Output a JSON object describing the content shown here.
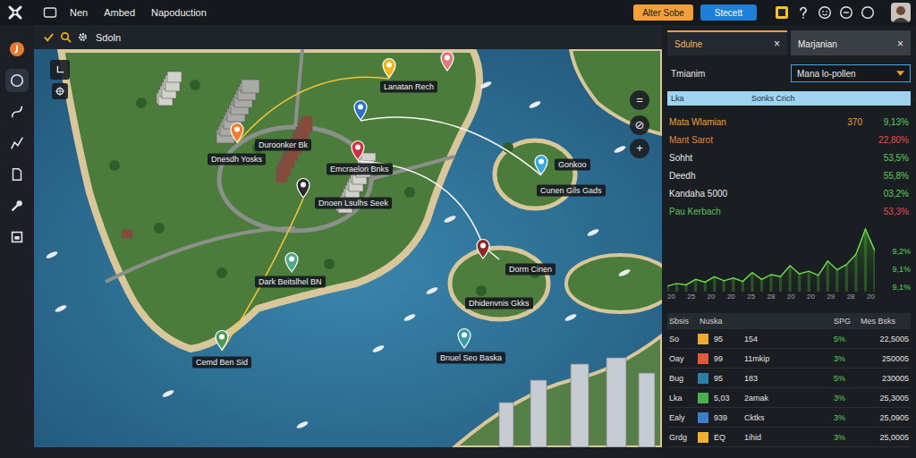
{
  "topbar": {
    "nav": [
      {
        "label": "Nen",
        "selected": false
      },
      {
        "label": "Ambed",
        "selected": false
      },
      {
        "label": "Napoduction",
        "selected": false
      }
    ],
    "buttons": [
      {
        "label": "Alter Sobe",
        "kind": "warning"
      },
      {
        "label": "Stecett",
        "kind": "primary"
      }
    ]
  },
  "sidebar": {
    "items": [
      {
        "selected": false
      },
      {
        "selected": true
      },
      {
        "selected": false
      },
      {
        "selected": false
      },
      {
        "selected": false
      },
      {
        "selected": false
      },
      {
        "selected": false
      }
    ]
  },
  "toolbar": {
    "title": "Sdoln"
  },
  "map": {
    "controls": [
      "=",
      "⊘",
      "+"
    ],
    "pins": [
      {
        "color": "#e07a7a"
      },
      {
        "color": "#f2b51c"
      },
      {
        "color": "#2a6fc9"
      },
      {
        "color": "#ef7d2d"
      },
      {
        "color": "#d0313b"
      },
      {
        "color": "#2a2a2a"
      },
      {
        "color": "#4fa88a"
      },
      {
        "color": "#4c9a5a"
      },
      {
        "color": "#3aa8d8"
      },
      {
        "color": "#3a9aa8"
      },
      {
        "color": "#8a2a2a"
      }
    ],
    "labels": [
      "Lanatan Rech",
      "Duroonker Bk",
      "Dnesdh Yosks",
      "Emcraelon Bnks",
      "Dnoen Lsulhs Seek",
      "Dark Beitslhel BN",
      "Cemd Ben Sid",
      "Gonkoo",
      "Cunen Gils Gads",
      "Dorm Cinen",
      "Dhidenvnis Gkks",
      "Bnuel Seo Baska"
    ]
  },
  "panel": {
    "tabs": [
      {
        "label": "Sdulne",
        "close": "×",
        "selected": true
      },
      {
        "label": "Marjanian",
        "close": "×",
        "selected": false
      }
    ],
    "field": {
      "label": "Tmianim",
      "value": "Mana lo-pollen"
    },
    "strip": {
      "left": "Lka",
      "center": "Sonks Crich"
    },
    "stats": [
      {
        "name": "Mata Wlamian",
        "value": "370",
        "change": "9,13%",
        "trend": "up",
        "color": "#f0a030"
      },
      {
        "name": "Mant Sarot",
        "change": "22,80%",
        "trend": "down",
        "color": "#e8843a"
      },
      {
        "name": "Sohht",
        "change": "53,5%",
        "trend": "up",
        "color": "#e8e8e8"
      },
      {
        "name": "Deedh",
        "change": "55,8%",
        "trend": "up",
        "color": "#e8e8e8"
      },
      {
        "name": "Kandaha 5000",
        "change": "03,2%",
        "trend": "up",
        "color": "#e8e8e8"
      },
      {
        "name": "Pau Kerbach",
        "change": "53,3%",
        "trend": "down",
        "color": "#5cc05c"
      }
    ],
    "chart": {
      "series": [
        {
          "values": [
            8,
            12,
            10,
            18,
            14,
            22,
            16,
            20,
            15,
            28,
            18,
            25,
            22,
            38,
            26,
            30,
            24,
            45,
            32,
            40,
            55,
            92,
            60
          ]
        }
      ],
      "x_ticks": [
        "20",
        "25",
        "20",
        "20",
        "25",
        "28",
        "20",
        "20",
        "29",
        "28",
        "20"
      ],
      "y_ticks": [
        "9,2%",
        "9,1%",
        "9,1%"
      ]
    },
    "table": {
      "columns": [
        "Sbsis",
        "Nuska",
        "SPG",
        "Mes Bsks"
      ],
      "rows": [
        {
          "name": "So",
          "color": "#f0a830",
          "qty": "95",
          "code": "154",
          "pct": "5%",
          "value": "22,5005"
        },
        {
          "name": "Oay",
          "color": "#e05a3a",
          "qty": "99",
          "code": "11mkip",
          "pct": "3%",
          "value": "250005"
        },
        {
          "name": "Bug",
          "color": "#2a7fa8",
          "qty": "95",
          "code": "183",
          "pct": "5%",
          "value": "230005"
        },
        {
          "name": "Lka",
          "color": "#4caf50",
          "qty": "5,03",
          "code": "2amak",
          "pct": "3%",
          "value": "25,3005"
        },
        {
          "name": "Ealy",
          "color": "#3a7fc8",
          "qty": "939",
          "code": "Cktks",
          "pct": "3%",
          "value": "25,0905"
        },
        {
          "name": "Grdg",
          "color": "#f0b030",
          "qty": "EQ",
          "code": "1ihid",
          "pct": "3%",
          "value": "25,0005"
        }
      ]
    }
  }
}
